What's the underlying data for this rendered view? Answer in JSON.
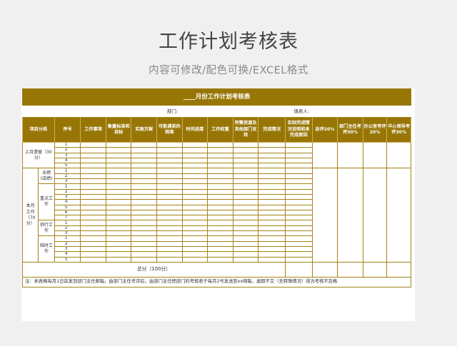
{
  "page": {
    "title": "工作计划考核表",
    "subtitle": "内容可修改/配色可换/EXCEL格式"
  },
  "sheet": {
    "table_title": "____月份工作计划考核表",
    "department_label": "部门:",
    "filler_label": "填表人:",
    "headers": [
      "项目分类",
      "序号",
      "工作事项",
      "衡量标准和目标",
      "实施方案",
      "可能遇到的困难",
      "时间进度",
      "工作权重",
      "所需资源及其他部门支持",
      "完成情况",
      "实际完成情况说明和未完成原因",
      "自评20%",
      "部门主任考评30%",
      "办公室考评20%",
      "中心领导考评30%"
    ],
    "cat_prev": "上月遗留（30分）",
    "cat_prev_col1": "分）",
    "cat_prev_col2": "（30",
    "cat_prev_col3": "上月遗留",
    "cat_month": "本月工作（70分）",
    "sub_items": [
      "业绩(成绩)",
      "重点工作",
      "例行工作",
      "临时工作"
    ],
    "prev_numbers": [
      "1",
      "2",
      "3",
      "4",
      "5"
    ],
    "perf_numbers": [
      "1",
      "2",
      "3"
    ],
    "key_numbers": [
      "1",
      "2",
      "3",
      "4",
      "5",
      "6",
      "7"
    ],
    "routine_numbers": [
      "1",
      "2",
      "3"
    ],
    "temp_numbers": [
      "1",
      "2",
      "3",
      "4",
      "5"
    ],
    "total_label": "总分（100分）",
    "note": "注：本表格每月1日前发到部门主任邮箱，由部门主任考评后，由部门主任把部门的考核表于每月2号发送到xx邮箱，逾期不交（无特殊情况）视为考核不及格"
  },
  "colors": {
    "accent": "#987606",
    "border": "#a38417"
  }
}
